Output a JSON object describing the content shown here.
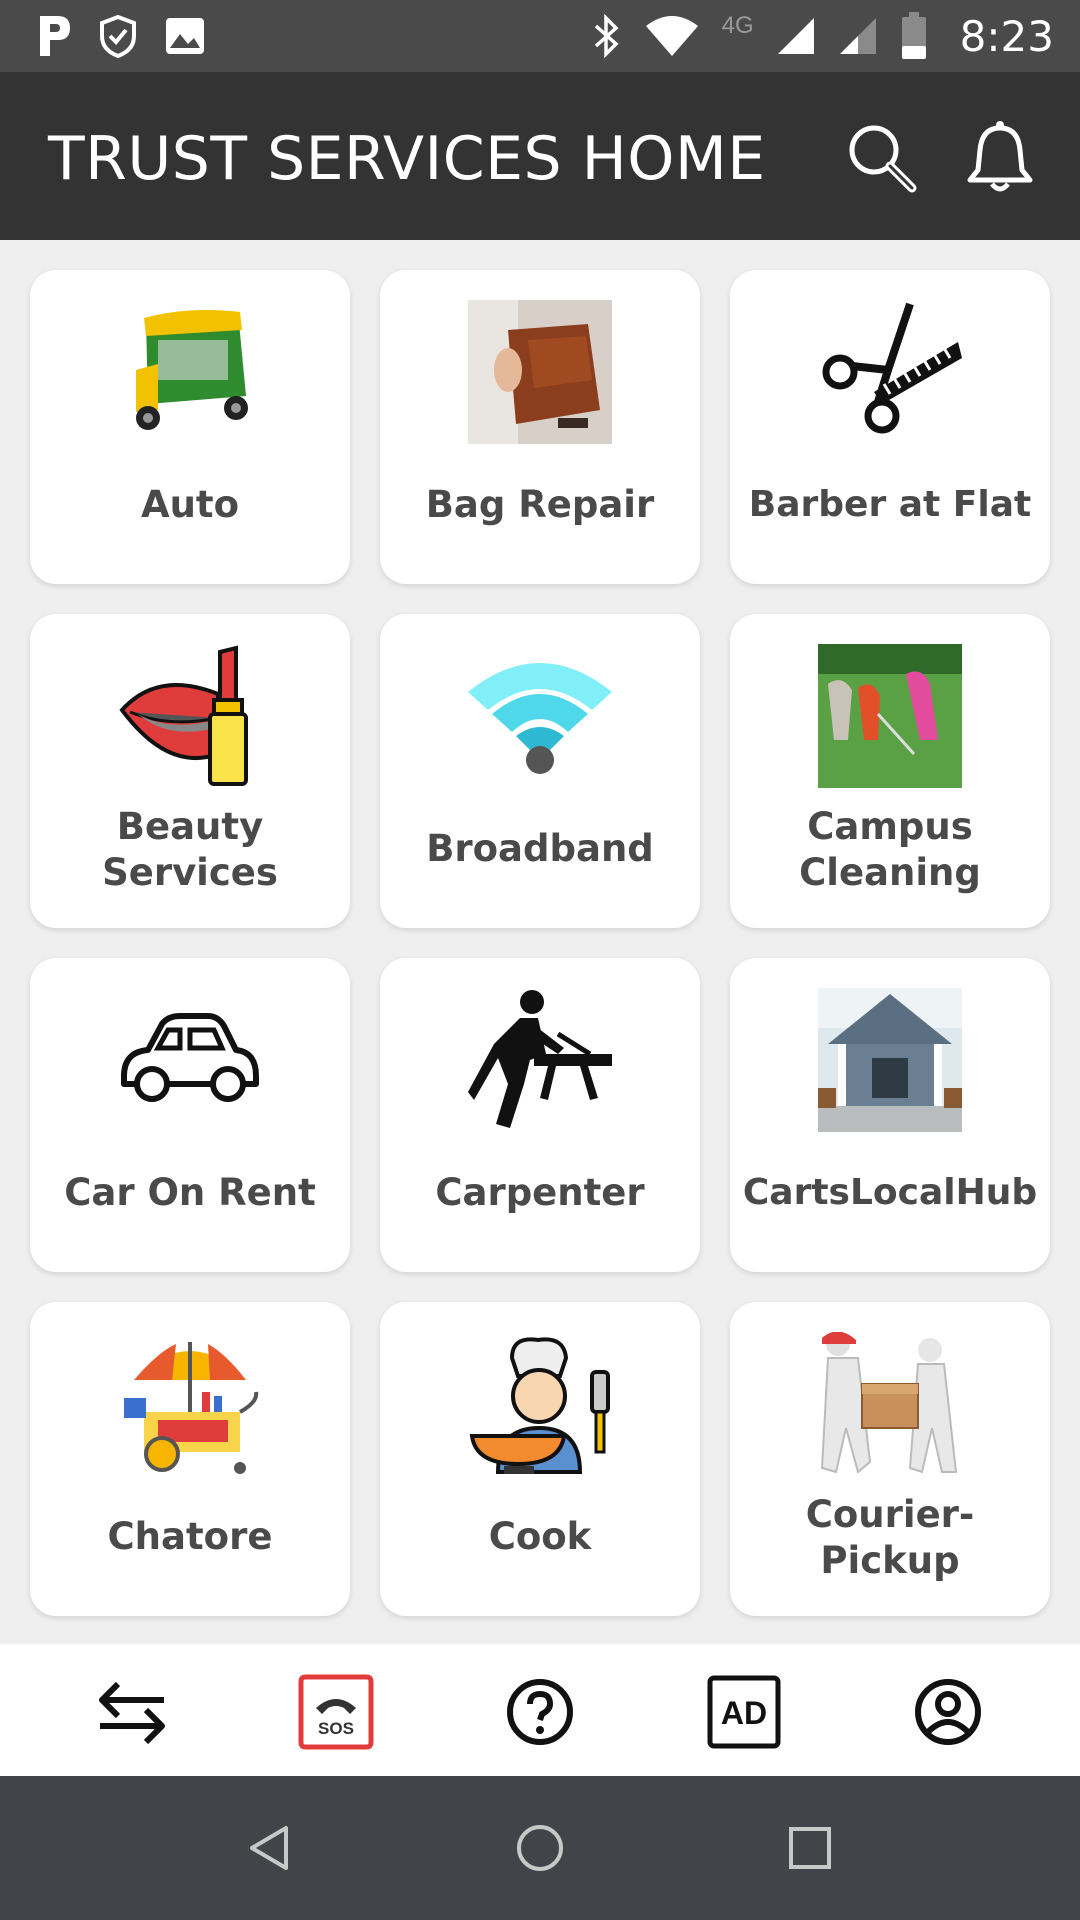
{
  "status_bar": {
    "time": "8:23",
    "network": "4G",
    "icons": [
      "app-p-icon",
      "shield-check-icon",
      "image-icon",
      "bluetooth-icon",
      "wifi-icon",
      "signal-icon",
      "signal-weak-icon",
      "battery-icon"
    ]
  },
  "app_bar": {
    "title": "TRUST SERVICES HOME",
    "actions": [
      "search-icon",
      "bell-icon"
    ]
  },
  "services": [
    {
      "label": "Auto",
      "icon": "auto-rickshaw-icon"
    },
    {
      "label": "Bag Repair",
      "icon": "bag-repair-photo"
    },
    {
      "label": "Barber at Flat",
      "icon": "scissors-comb-icon"
    },
    {
      "label": "Beauty Services",
      "icon": "lipstick-lips-icon"
    },
    {
      "label": "Broadband",
      "icon": "wifi-icon"
    },
    {
      "label": "Campus Cleaning",
      "icon": "cleaning-photo"
    },
    {
      "label": "Car On Rent",
      "icon": "car-icon"
    },
    {
      "label": "Carpenter",
      "icon": "carpenter-icon"
    },
    {
      "label": "CartsLocalHub",
      "icon": "house-photo"
    },
    {
      "label": "Chatore",
      "icon": "food-cart-icon"
    },
    {
      "label": "Cook",
      "icon": "chef-icon"
    },
    {
      "label": "Courier-Pickup",
      "icon": "delivery-box-icon"
    }
  ],
  "bottom_nav": [
    "transfer-arrows-icon",
    "sos-phone-icon",
    "help-circle-icon",
    "ad-icon",
    "profile-icon"
  ],
  "colors": {
    "status_bar": "#4a4a4a",
    "app_bar": "#333333",
    "background": "#efefef",
    "sos_accent": "#e03c3c",
    "system_nav": "#414449"
  }
}
